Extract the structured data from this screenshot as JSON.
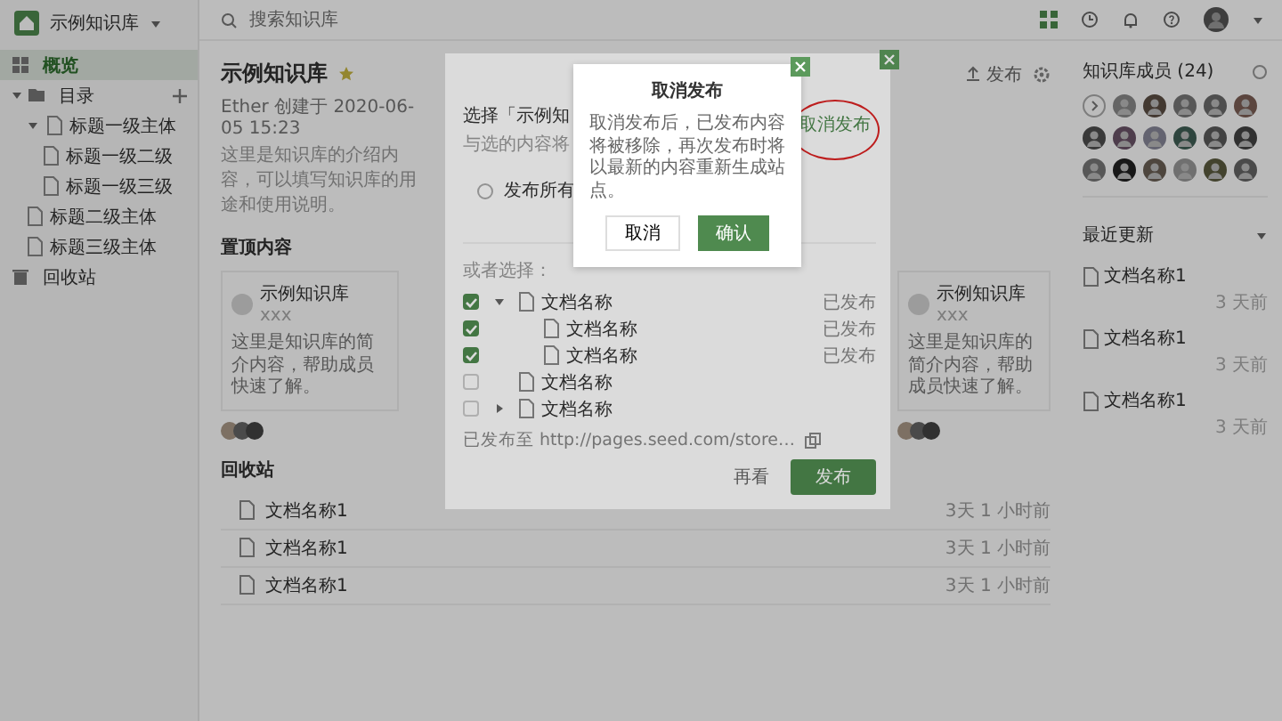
{
  "sidebar": {
    "space": "示例知识库",
    "items": [
      {
        "label": "概览",
        "kind": "overview",
        "selected": true
      },
      {
        "label": "目录",
        "kind": "catalog",
        "selected": false,
        "expanded": true,
        "children": [
          {
            "label": "标题一级主体",
            "selected": false,
            "expanded": true,
            "children": [
              {
                "label": "标题一级二级",
                "selected": false
              },
              {
                "label": "标题一级三级",
                "selected": false
              }
            ]
          },
          {
            "label": "标题二级主体",
            "selected": false
          },
          {
            "label": "标题三级主体",
            "selected": false
          }
        ]
      },
      {
        "label": "回收站",
        "kind": "trash",
        "selected": false
      }
    ]
  },
  "search": {
    "placeholder": "搜索知识库"
  },
  "space": {
    "title": "示例知识库",
    "starred": true,
    "meta": "Ether 创建于 2020-06-05 15:23",
    "description": "这里是知识库的介绍内容，可以填写知识库的用途和使用说明。",
    "publish": "发布"
  },
  "pinned": {
    "title": "置顶内容",
    "cards": [
      {
        "title": "示例知识库",
        "subtitle": "xxx",
        "text": "这里是知识库的简介内容，帮助成员快速了解。"
      },
      {
        "title": "示例知识库",
        "subtitle": "xxx",
        "text": "这里是知识库的简介内容，帮助成员快速了解。"
      }
    ]
  },
  "recent": {
    "title": "回收站",
    "rows": [
      {
        "name": "文档名称1",
        "time": "3天 1 小时前"
      },
      {
        "name": "文档名称1",
        "time": "3天 1 小时前"
      },
      {
        "name": "文档名称1",
        "time": "3天 1 小时前"
      }
    ]
  },
  "members": {
    "title": "知识库成员 (24)"
  },
  "updates": {
    "title": "最近更新",
    "rows": [
      {
        "name": "文档名称1",
        "time": "3 天前"
      },
      {
        "name": "文档名称1",
        "time": "3 天前"
      },
      {
        "name": "文档名称1",
        "time": "3 天前"
      }
    ]
  },
  "publish_dialog": {
    "title": "选择「示例知",
    "hint": "与选的内容将",
    "all_option": "发布所有",
    "all_selected": false,
    "unpublish": "取消发布",
    "section": "或者选择：",
    "tree": [
      {
        "name": "文档名称",
        "status": "已发布",
        "checked": true,
        "expanded": true,
        "children": [
          {
            "name": "文档名称",
            "status": "已发布",
            "checked": true
          },
          {
            "name": "文档名称",
            "status": "已发布",
            "checked": true
          }
        ]
      },
      {
        "name": "文档名称",
        "checked": false
      },
      {
        "name": "文档名称",
        "checked": false,
        "expanded": false
      }
    ],
    "link": "已发布至 http://pages.seed.com/store…",
    "secondary": "再看",
    "primary": "发布"
  },
  "confirm_modal": {
    "title": "取消发布",
    "message": "取消发布后，已发布内容将被移除，再次发布时将以最新的内容重新生成站点。",
    "cancel": "取消",
    "confirm": "确认"
  }
}
